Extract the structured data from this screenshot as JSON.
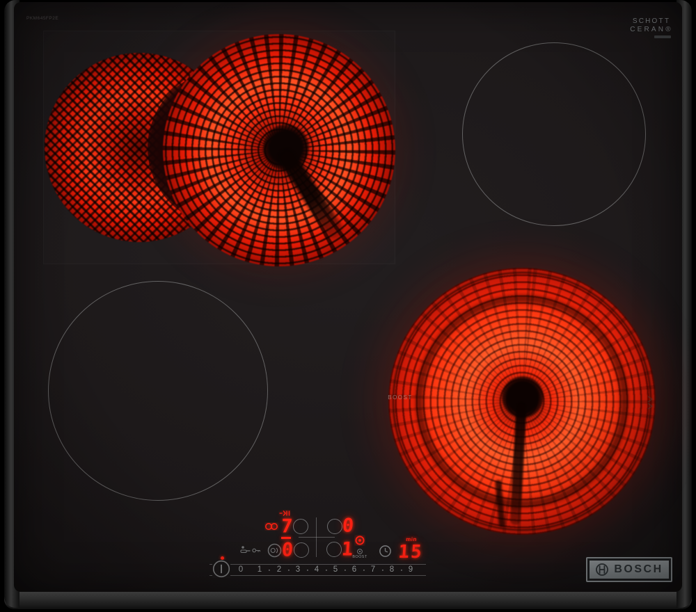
{
  "branding": {
    "model_number": "PKM645FP2E",
    "schott_line1": "SCHOTT",
    "schott_line2": "CERAN®",
    "bosch_logo": "BOSCH"
  },
  "surface": {
    "boost_print": "BOOST"
  },
  "panel": {
    "rear_left_level": "7",
    "rear_right_level": "0",
    "front_left_level": "0",
    "front_right_level": "1",
    "boost_key_label": "BOOST",
    "timer_value": "15",
    "timer_unit": "min",
    "slider_labels": [
      "0",
      "1",
      "2",
      "3",
      "4",
      "5",
      "6",
      "7",
      "8",
      "9"
    ]
  },
  "colors": {
    "led_red": "#ff2113",
    "print_gray": "#aeb2b5",
    "glow_red": "#ff3b12",
    "badge_gray": "#8a9093"
  }
}
